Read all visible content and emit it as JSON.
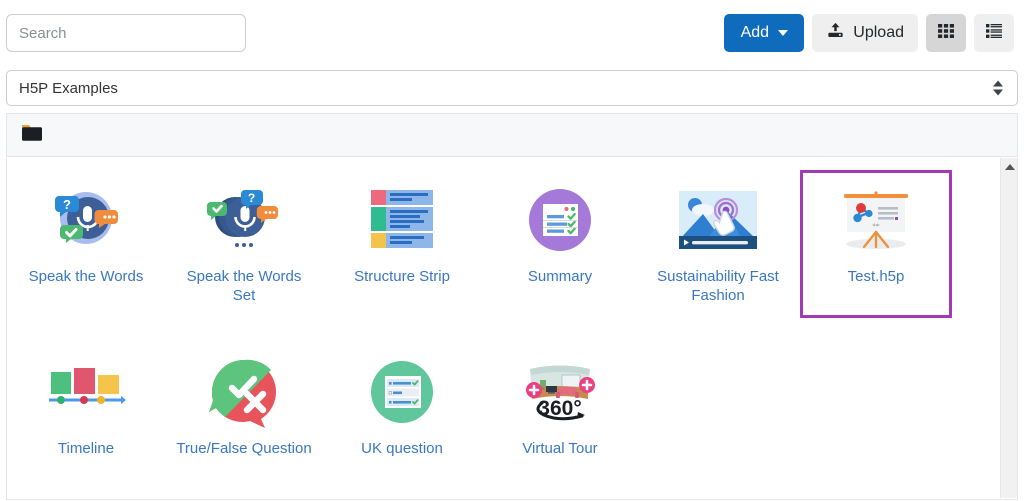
{
  "search": {
    "placeholder": "Search",
    "value": ""
  },
  "toolbar": {
    "add_label": "Add",
    "upload_label": "Upload",
    "grid_view_name": "grid-view",
    "list_view_name": "list-view",
    "accent_blue": "#0f6cbd",
    "button_grey": "#efefef",
    "button_grey_active": "#d6d6d6"
  },
  "folder_select": {
    "selected": "H5P Examples",
    "options": [
      "H5P Examples"
    ]
  },
  "breadcrumb": {
    "root_icon": "folder-icon",
    "path": ""
  },
  "colors": {
    "link_blue": "#3a77c2",
    "selection_purple": "#a33ab5",
    "panel_bg": "#f7f8fa"
  },
  "files": [
    {
      "name": "Speak the Words",
      "icon": "speak-the-words-icon",
      "selected": false
    },
    {
      "name": "Speak the Words Set",
      "icon": "speak-the-words-set-icon",
      "selected": false
    },
    {
      "name": "Structure Strip",
      "icon": "structure-strip-icon",
      "selected": false
    },
    {
      "name": "Summary",
      "icon": "summary-icon",
      "selected": false
    },
    {
      "name": "Sustainability Fast Fashion",
      "icon": "interactive-video-icon",
      "selected": false
    },
    {
      "name": "Test.h5p",
      "icon": "presentation-icon",
      "selected": true
    },
    {
      "name": "Timeline",
      "icon": "timeline-icon",
      "selected": false
    },
    {
      "name": "True/False Question",
      "icon": "true-false-icon",
      "selected": false
    },
    {
      "name": "UK question",
      "icon": "uk-question-icon",
      "selected": false
    },
    {
      "name": "Virtual Tour",
      "icon": "virtual-tour-360-icon",
      "selected": false
    }
  ],
  "scrollbar": {
    "position": "top",
    "up_arrow": "scroll-up-icon"
  }
}
